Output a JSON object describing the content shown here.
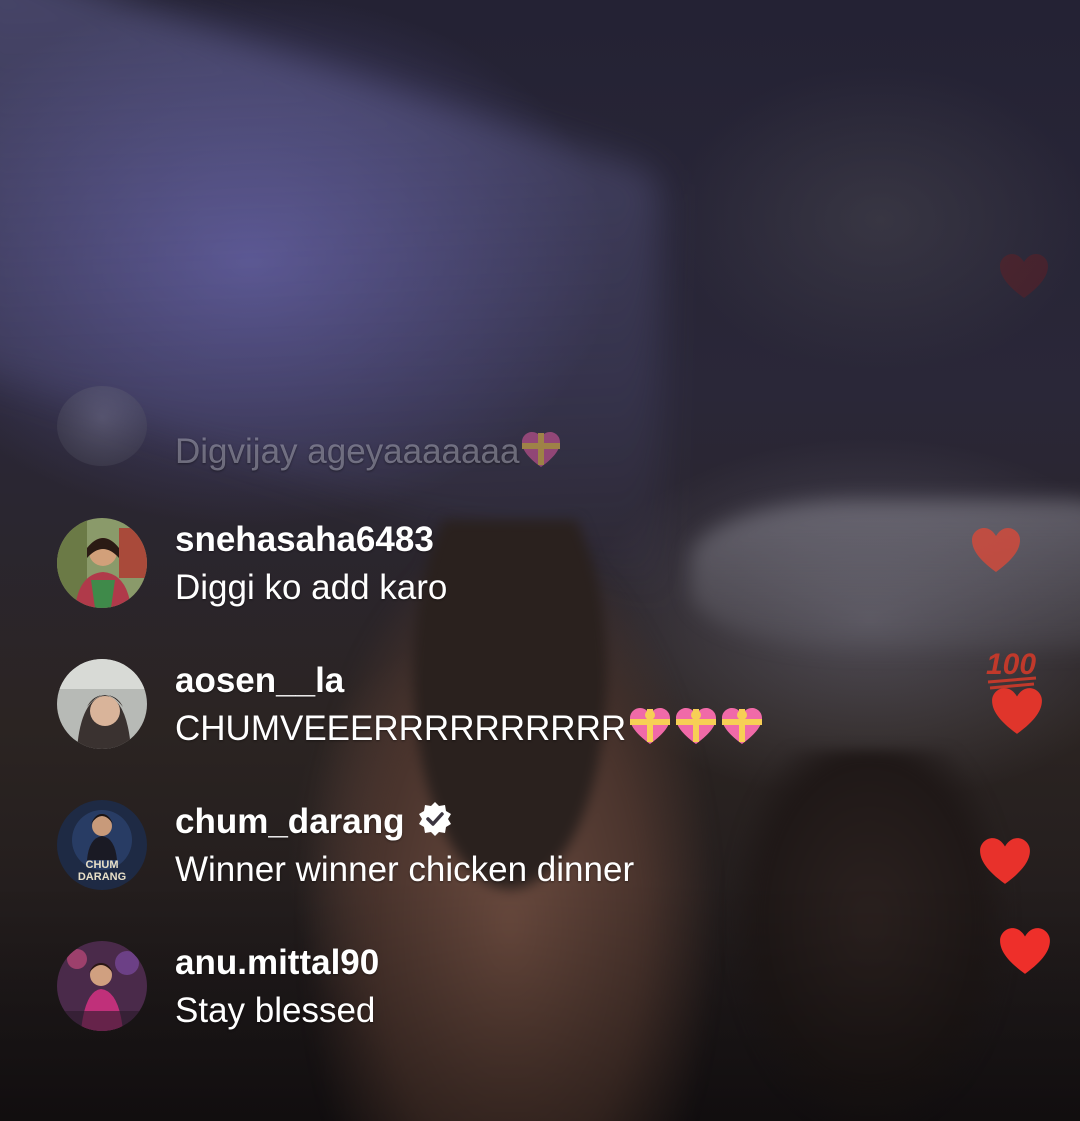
{
  "live_comments": [
    {
      "username": "",
      "message": "Digvijay ageyaaaaaaa",
      "message_emoji": "heart-with-ribbon",
      "faded": true,
      "verified": false
    },
    {
      "username": "snehasaha6483",
      "message": "Diggi ko add karo",
      "verified": false
    },
    {
      "username": "aosen__la",
      "message": "CHUMVEEERRRRRRRRRR",
      "message_emoji": "heart-with-ribbon x3",
      "verified": false
    },
    {
      "username": "chum_darang",
      "message": "Winner winner chicken dinner",
      "verified": true,
      "avatar_text": "CHUM DARANG"
    },
    {
      "username": "anu.mittal90",
      "message": "Stay blessed",
      "verified": false
    }
  ],
  "floating_reactions": [
    "red-heart",
    "red-heart",
    "hundred-points",
    "red-heart",
    "red-heart",
    "red-heart"
  ],
  "colors": {
    "text": "#ffffff",
    "heart_red": "#e8312b",
    "ribbon_pink": "#f06aa8"
  }
}
